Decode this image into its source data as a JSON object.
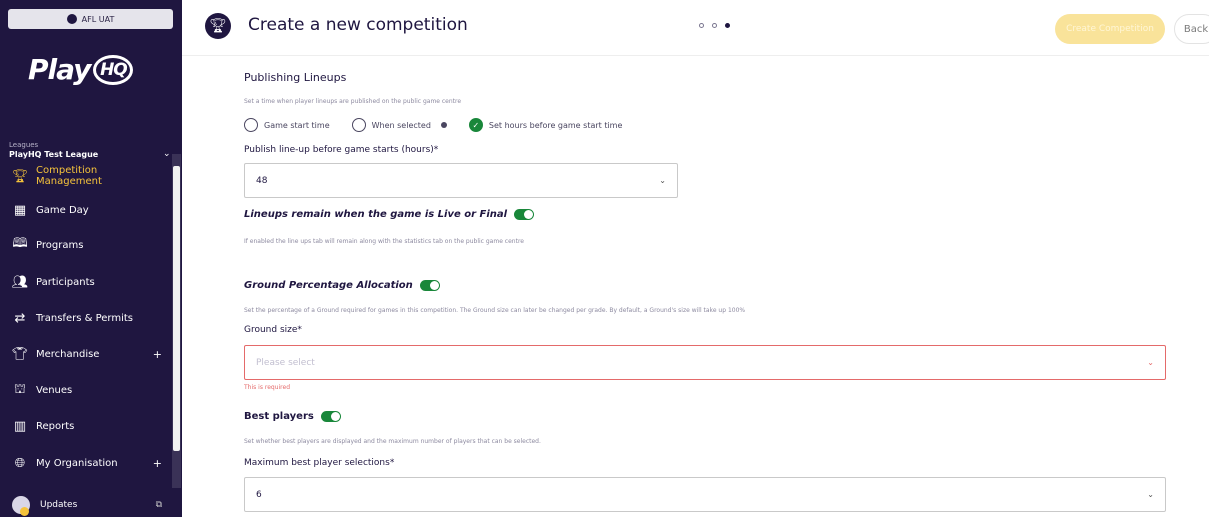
{
  "sidebar": {
    "org_pill": "AFL UAT",
    "logo_text": "Play",
    "logo_hq": "HQ",
    "league_label": "Leagues",
    "league_name": "PlayHQ Test League",
    "nav": [
      {
        "label": "Competition Management",
        "icon": "trophy-icon",
        "active": true
      },
      {
        "label": "Game Day",
        "icon": "scoreboard-icon"
      },
      {
        "label": "Programs",
        "icon": "book-icon"
      },
      {
        "label": "Participants",
        "icon": "people-icon"
      },
      {
        "label": "Transfers & Permits",
        "icon": "transfer-icon"
      },
      {
        "label": "Merchandise",
        "icon": "shirt-icon",
        "plus": "+"
      },
      {
        "label": "Venues",
        "icon": "stadium-icon"
      },
      {
        "label": "Reports",
        "icon": "report-icon"
      },
      {
        "label": "My Organisation",
        "icon": "globe-icon",
        "plus": "+"
      }
    ],
    "updates_label": "Updates"
  },
  "header": {
    "title": "Create a new competition",
    "create_label": "Create Competition",
    "back_label": "Back",
    "steps_total": 3,
    "current_step": 3
  },
  "form": {
    "publishing": {
      "title": "Publishing Lineups",
      "help": "Set a time when player lineups are published on the public game centre",
      "options": [
        "Game start time",
        "When selected",
        "Set hours before game start time"
      ],
      "selected_index": 2
    },
    "publish_hours": {
      "label": "Publish line-up before game starts (hours)*",
      "value": "48"
    },
    "lineups_remain": {
      "label": "Lineups remain when the game is Live or Final",
      "enabled": true,
      "help": "If enabled the line ups tab will remain along with the statistics tab on the public game centre"
    },
    "ground_allocation": {
      "label": "Ground Percentage Allocation",
      "enabled": true,
      "help": "Set the percentage of a Ground required for games in this competition. The Ground size can later be changed per grade. By default, a Ground's size will take up 100%"
    },
    "ground_size": {
      "label": "Ground size*",
      "placeholder": "Please select",
      "error": "This is required"
    },
    "best_players": {
      "label": "Best players",
      "enabled": true,
      "help": "Set whether best players are displayed and the maximum number of players that can be selected."
    },
    "max_best": {
      "label": "Maximum best player selections*",
      "value": "6"
    }
  },
  "colors": {
    "sidebar_bg": "#1f1640",
    "accent_yellow": "#f5c33b",
    "toggle_green": "#19873a",
    "error_red": "#e46a6a"
  }
}
